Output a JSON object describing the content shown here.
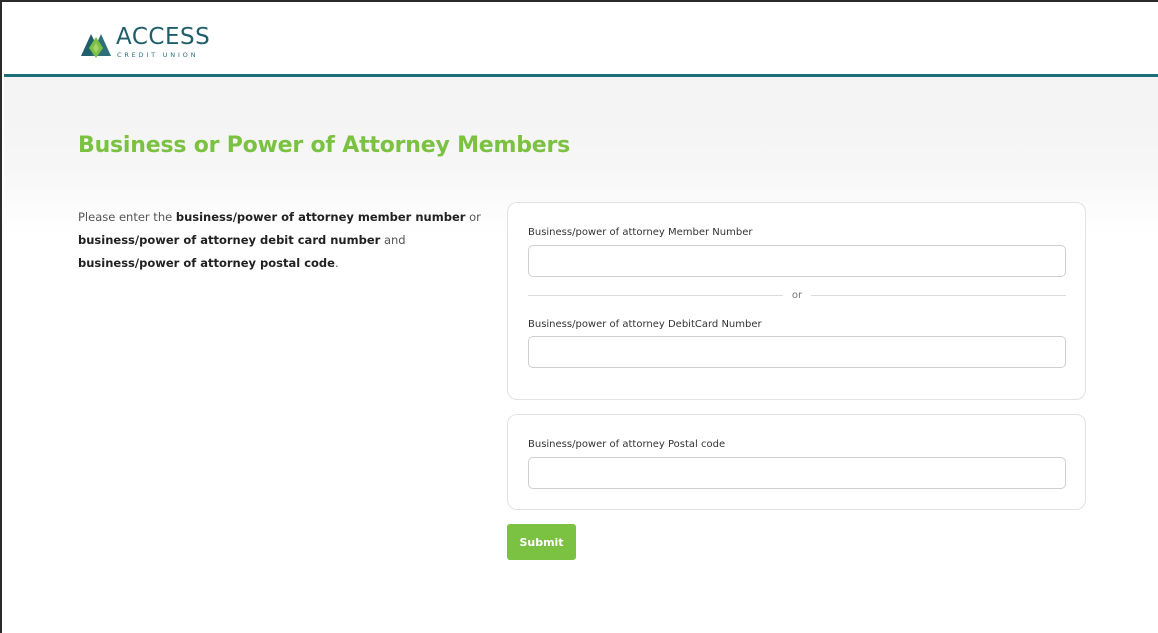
{
  "brand": {
    "name": "ACCESS",
    "tagline": "CREDIT UNION",
    "colors": {
      "accent_green": "#7cc242",
      "teal": "#1f6f7a"
    },
    "logo_icon": "access-mountain-logo-icon"
  },
  "page": {
    "title": "Business or Power of Attorney Members"
  },
  "intro": {
    "p1": "Please enter the ",
    "b1": "business/power of attorney member number",
    "p2": " or ",
    "b2": "business/power of attorney debit card number",
    "p3": " and ",
    "b3": "business/power of attorney postal code",
    "p4": "."
  },
  "form": {
    "member_number": {
      "label": "Business/power of attorney Member Number",
      "value": "",
      "placeholder": ""
    },
    "separator": "or",
    "debit_card_number": {
      "label": "Business/power of attorney DebitCard Number",
      "value": "",
      "placeholder": ""
    },
    "postal_code": {
      "label": "Business/power of attorney Postal code",
      "value": "",
      "placeholder": ""
    },
    "submit_label": "Submit"
  }
}
